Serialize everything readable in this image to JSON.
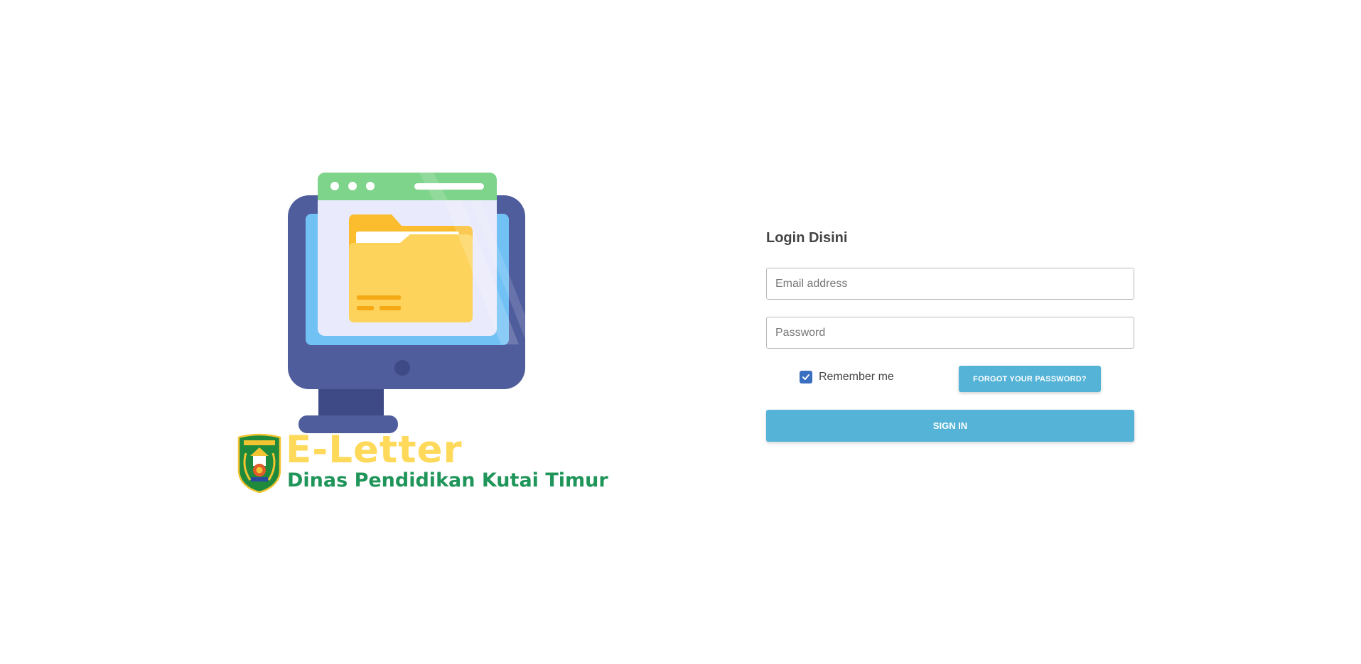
{
  "brand": {
    "title": "E-Letter",
    "subtitle": "Dinas Pendidikan Kutai Timur",
    "emblem_icon": "kutai-timur-emblem-icon",
    "illustration_icon": "monitor-folder-illustration",
    "title_color": "#ffd95a",
    "subtitle_color": "#20955a"
  },
  "login": {
    "heading": "Login Disini",
    "email": {
      "value": "",
      "placeholder": "Email address"
    },
    "password": {
      "value": "",
      "placeholder": "Password"
    },
    "remember": {
      "label": "Remember me",
      "checked": true
    },
    "forgot_label": "FORGOT YOUR PASSWORD?",
    "signin_label": "SIGN IN",
    "accent_color": "#54b3d6"
  }
}
